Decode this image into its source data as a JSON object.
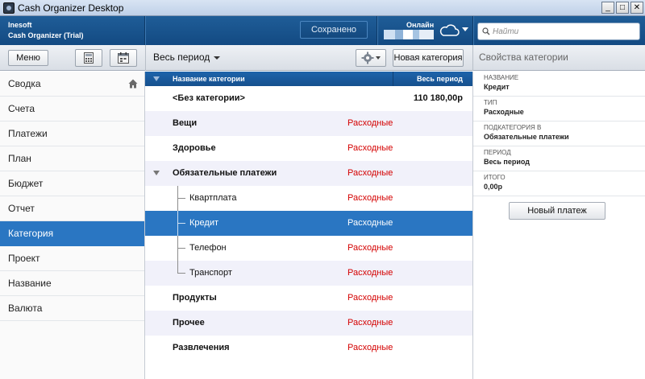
{
  "window": {
    "title": "Cash Organizer Desktop"
  },
  "header": {
    "company": "Inesoft",
    "product": "Cash Organizer (Trial)",
    "saved_label": "Сохранено",
    "online_label": "Онлайн",
    "search_placeholder": "Найти"
  },
  "toolbar": {
    "menu_label": "Меню",
    "calculator_icon": "calculator-icon",
    "calendar_icon": "calendar-icon",
    "period_label": "Весь период",
    "settings_icon": "gear-icon",
    "new_category_label": "Новая категория",
    "properties_title": "Свойства категории"
  },
  "sidebar": {
    "items": [
      {
        "label": "Сводка",
        "icon": "home-icon"
      },
      {
        "label": "Счета"
      },
      {
        "label": "Платежи"
      },
      {
        "label": "План"
      },
      {
        "label": "Бюджет"
      },
      {
        "label": "Отчет"
      },
      {
        "label": "Категория",
        "active": true
      },
      {
        "label": "Проект"
      },
      {
        "label": "Название"
      },
      {
        "label": "Валюта"
      }
    ]
  },
  "table": {
    "columns": {
      "name": "Название категории",
      "period": "Весь период"
    },
    "rows": [
      {
        "name": "<Без категории>",
        "type": "",
        "amount": "110 180,00р",
        "bold": true
      },
      {
        "name": "Вещи",
        "type": "Расходные",
        "amount": "",
        "bold": true
      },
      {
        "name": "Здоровье",
        "type": "Расходные",
        "amount": "",
        "bold": true
      },
      {
        "name": "Обязательные платежи",
        "type": "Расходные",
        "amount": "",
        "bold": true,
        "expanded": true
      },
      {
        "name": "Квартплата",
        "type": "Расходные",
        "amount": "",
        "child": true
      },
      {
        "name": "Кредит",
        "type": "Расходные",
        "amount": "",
        "child": true,
        "selected": true
      },
      {
        "name": "Телефон",
        "type": "Расходные",
        "amount": "",
        "child": true
      },
      {
        "name": "Транспорт",
        "type": "Расходные",
        "amount": "",
        "child": true
      },
      {
        "name": "Продукты",
        "type": "Расходные",
        "amount": "",
        "bold": true
      },
      {
        "name": "Прочее",
        "type": "Расходные",
        "amount": "",
        "bold": true
      },
      {
        "name": "Развлечения",
        "type": "Расходные",
        "amount": "",
        "bold": true
      }
    ]
  },
  "properties": {
    "fields": [
      {
        "label": "Название",
        "value": "Кредит"
      },
      {
        "label": "Тип",
        "value": "Расходные"
      },
      {
        "label": "Подкатегория в",
        "value": "Обязательные платежи"
      },
      {
        "label": "Период",
        "value": "Весь период"
      },
      {
        "label": "Итого",
        "value": "0,00р"
      }
    ],
    "new_payment_label": "Новый платеж"
  },
  "colors": {
    "header_blue": "#1a568f",
    "selection_blue": "#2a76c2",
    "expense_red": "#d40000"
  }
}
